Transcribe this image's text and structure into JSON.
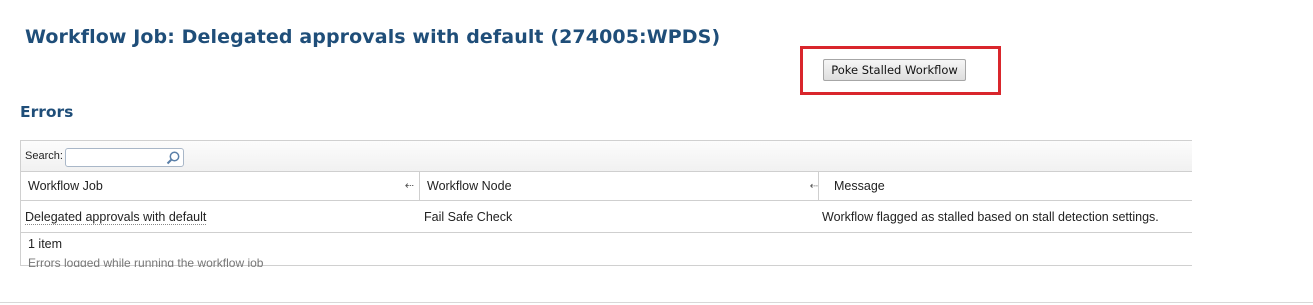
{
  "page": {
    "title": "Workflow Job: Delegated approvals with default (274005:WPDS)"
  },
  "actions": {
    "poke_button_label": "Poke Stalled Workflow",
    "highlight_color": "#d9262c"
  },
  "errors_section": {
    "heading": "Errors",
    "search": {
      "label": "Search:",
      "value": "",
      "placeholder": ""
    },
    "columns": [
      "Workflow Job",
      "Workflow Node",
      "Message"
    ],
    "rows": [
      {
        "workflow_job": "Delegated approvals with default",
        "workflow_node": "Fail Safe Check",
        "message": "Workflow flagged as stalled based on stall detection settings."
      }
    ],
    "item_count": "1 item",
    "footer_note": "Errors logged while running the workflow job"
  },
  "colors": {
    "heading": "#1f4e79",
    "accent_border": "#d9262c"
  },
  "icons": {
    "search": "search-icon",
    "sort": "sort-icon"
  }
}
